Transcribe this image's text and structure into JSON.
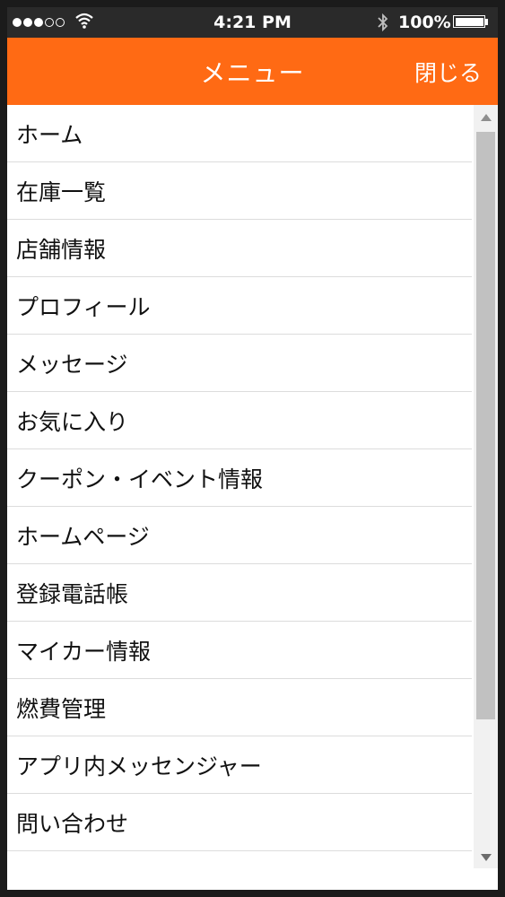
{
  "status_bar": {
    "time": "4:21 PM",
    "battery_percent": "100%",
    "signal_icons": [
      "signal-dot-filled",
      "signal-dot-filled",
      "signal-dot-filled",
      "signal-dot-empty",
      "signal-dot-empty"
    ],
    "wifi_icon": "wifi-icon",
    "bluetooth_icon": "bluetooth-icon",
    "battery_icon": "battery-icon",
    "battery_level": 1.0
  },
  "nav_bar": {
    "title": "メニュー",
    "close_label": "閉じる",
    "color": "#ff6a14"
  },
  "menu": {
    "items": [
      {
        "label": "ホーム"
      },
      {
        "label": "在庫一覧"
      },
      {
        "label": "店舗情報"
      },
      {
        "label": "プロフィール"
      },
      {
        "label": "メッセージ"
      },
      {
        "label": "お気に入り"
      },
      {
        "label": "クーポン・イベント情報"
      },
      {
        "label": "ホームページ"
      },
      {
        "label": "登録電話帳"
      },
      {
        "label": "マイカー情報"
      },
      {
        "label": "燃費管理"
      },
      {
        "label": "アプリ内メッセンジャー"
      },
      {
        "label": "問い合わせ"
      }
    ]
  },
  "scrollbar": {
    "up_icon": "scroll-up-arrow-icon",
    "down_icon": "scroll-down-arrow-icon"
  }
}
